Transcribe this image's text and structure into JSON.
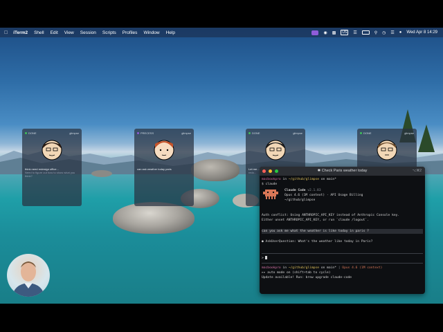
{
  "menubar": {
    "app": "iTerm2",
    "items": [
      "Shell",
      "Edit",
      "View",
      "Session",
      "Scripts",
      "Profiles",
      "Window",
      "Help"
    ],
    "status": {
      "input_source": "US",
      "datetime": "Wed Apr 8  14:29"
    }
  },
  "cards": [
    {
      "status": "DONE",
      "repo": "glimpse",
      "text": "think need redesign office...",
      "sub": "Need to figure out how to show what you think?"
    },
    {
      "status": "PRECESS",
      "repo": "glimpse",
      "text": "can ask weather today paris",
      "sub": ""
    },
    {
      "status": "DONE",
      "repo": "glimpse",
      "text": "Let me...",
      "sub": "redo..."
    },
    {
      "status": "DONE",
      "repo": "glimpse",
      "text": "",
      "sub": ""
    }
  ],
  "terminal": {
    "title": "Check Paris weather today",
    "shortcut": "⌥⌘2",
    "prompt1": {
      "host": "macbookpro",
      "dir": "~/github/glimpse",
      "branch": "main*"
    },
    "command": "$ claude",
    "banner": {
      "name": "Claude Code",
      "version": "v2.1.83",
      "model": "Opus 4.6 (1M context) · API Usage Billing",
      "path": "~/github/glimpse"
    },
    "warning1": "Auth conflict: Using ANTHROPIC_API_KEY instead of Anthropic Console key.",
    "warning2": "Either unset ANTHROPIC_API_KEY, or run `claude /logout`.",
    "user_msg": "can you ask me what the weather is like today in paris ?",
    "tool_line": "AskUserQuestion: What's the weather like today in Paris?",
    "input_prompt": ">",
    "prompt2": {
      "host": "macbookpro",
      "dir": "~/github/glimpse",
      "branch": "main*",
      "model": "Opus 4.6 (1M context)"
    },
    "auto_mode": "▸▸ auto mode on (shift+tab to cycle)",
    "update": "Update available! Run: brew upgrade claude-code"
  }
}
